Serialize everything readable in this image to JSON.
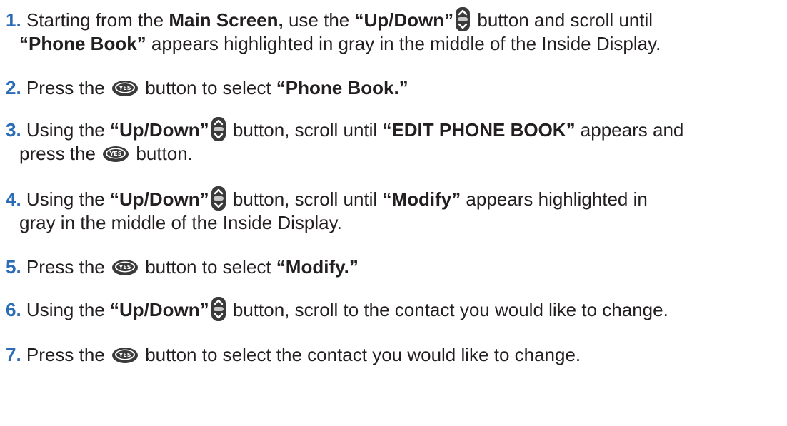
{
  "steps": [
    {
      "number": "1.",
      "line1": [
        {
          "t": "Starting from the ",
          "b": false
        },
        {
          "t": "Main Screen,",
          "b": true
        },
        {
          "t": " use the ",
          "b": false
        },
        {
          "t": "“Up/Down”",
          "b": true
        },
        {
          "icon": "updown"
        },
        {
          "t": "  button and scroll until",
          "b": false
        }
      ],
      "line2": [
        {
          "t": "“Phone Book”",
          "b": true
        },
        {
          "t": " appears highlighted in gray in the middle of the Inside Display.",
          "b": false
        }
      ]
    },
    {
      "number": "2.",
      "line1": [
        {
          "t": "Press the ",
          "b": false
        },
        {
          "icon": "yes"
        },
        {
          "t": " button to select ",
          "b": false
        },
        {
          "t": "“Phone Book.”",
          "b": true
        }
      ]
    },
    {
      "number": "3.",
      "line1": [
        {
          "t": "Using the ",
          "b": false
        },
        {
          "t": "“Up/Down”",
          "b": true
        },
        {
          "icon": "updown"
        },
        {
          "t": " button, scroll until ",
          "b": false
        },
        {
          "t": "“EDIT PHONE BOOK”",
          "b": true
        },
        {
          "t": " appears and",
          "b": false
        }
      ],
      "line2": [
        {
          "t": "press the ",
          "b": false
        },
        {
          "icon": "yes"
        },
        {
          "t": " button.",
          "b": false
        }
      ]
    },
    {
      "number": "4.",
      "line1": [
        {
          "t": "Using the ",
          "b": false
        },
        {
          "t": "“Up/Down”",
          "b": true
        },
        {
          "icon": "updown"
        },
        {
          "t": " button, scroll until ",
          "b": false
        },
        {
          "t": "“Modify”",
          "b": true
        },
        {
          "t": " appears highlighted in",
          "b": false
        }
      ],
      "line2": [
        {
          "t": "gray in the middle of the Inside Display.",
          "b": false
        }
      ]
    },
    {
      "number": "5.",
      "line1": [
        {
          "t": "Press the ",
          "b": false
        },
        {
          "icon": "yes"
        },
        {
          "t": " button to select ",
          "b": false
        },
        {
          "t": "“Modify.”",
          "b": true
        }
      ]
    },
    {
      "number": "6.",
      "line1": [
        {
          "t": "Using the ",
          "b": false
        },
        {
          "t": "“Up/Down”",
          "b": true
        },
        {
          "icon": "updown"
        },
        {
          "t": " button, scroll to the contact you would like to change.",
          "b": false
        }
      ]
    },
    {
      "number": "7.",
      "line1": [
        {
          "t": "Press the ",
          "b": false
        },
        {
          "icon": "yes"
        },
        {
          "t": " button to select the contact you would like to change.",
          "b": false
        }
      ]
    }
  ],
  "icons": {
    "updown": {
      "name": "up-down-button-icon",
      "color": "#3a3a3a"
    },
    "yes": {
      "name": "yes-button-icon",
      "label": "YES",
      "color": "#3a3a3a"
    }
  },
  "colors": {
    "number": "#2b6cb6",
    "text": "#231f20"
  }
}
